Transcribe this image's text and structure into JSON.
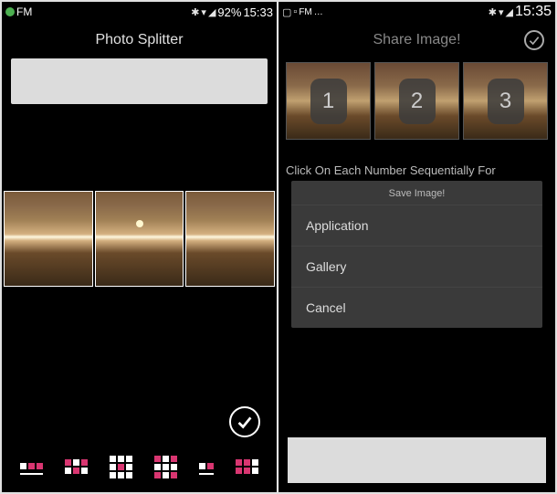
{
  "left": {
    "status": {
      "carrier": "FM",
      "battery": "92%",
      "time": "15:33"
    },
    "title": "Photo Splitter"
  },
  "right": {
    "status": {
      "carrier": "FM",
      "time": "15:35"
    },
    "title": "Share Image!",
    "thumbs": [
      "1",
      "2",
      "3"
    ],
    "instruction": "Click On Each Number Sequentially For",
    "dialog": {
      "title": "Save Image!",
      "app": "Application",
      "gallery": "Gallery",
      "cancel": "Cancel"
    }
  }
}
